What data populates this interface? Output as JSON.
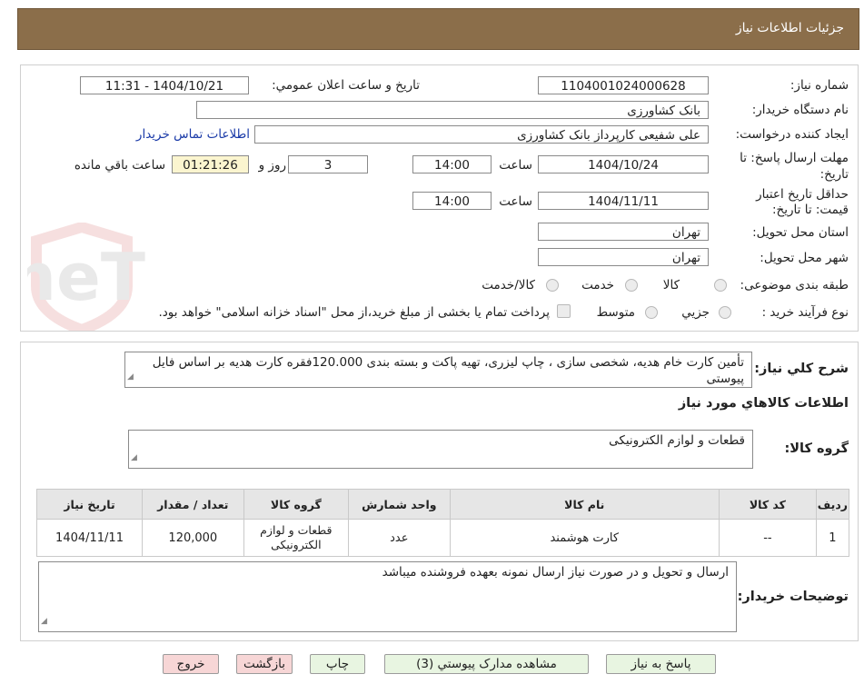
{
  "header": {
    "title": "جزئیات اطلاعات نیاز"
  },
  "watermark": {
    "text": "AriaTender.neT"
  },
  "form": {
    "need_number_label": "شماره نیاز:",
    "need_number": "1104001024000628",
    "announce_label": "تاریخ و ساعت اعلان عمومي:",
    "announce_value": "1404/10/21 - 11:31",
    "buyer_org_label": "نام دستگاه خريدار:",
    "buyer_org": "بانک کشاورزی",
    "creator_label": "ايجاد کننده درخواست:",
    "creator": "علی شفیعی کارپرداز بانک کشاورزی",
    "contact_link": "اطلاعات تماس خریدار",
    "deadline_label_1": "مهلت ارسال پاسخ: تا",
    "deadline_label_2": "تاريخ:",
    "deadline_date": "1404/10/24",
    "time_label": "ساعت",
    "deadline_time": "14:00",
    "days": "3",
    "days_label": "روز و",
    "remaining": "01:21:26",
    "remaining_label": "ساعت باقي مانده",
    "validity_label_1": "حداقل تاريخ اعتبار",
    "validity_label_2": "قيمت: تا تاريخ:",
    "validity_date": "1404/11/11",
    "validity_time_label": "ساعت",
    "validity_time": "14:00",
    "province_label": "استان محل تحويل:",
    "province": "تهران",
    "city_label": "شهر محل تحويل:",
    "city": "تهران",
    "category_label": "طبقه بندی موضوعی:",
    "category_options": [
      "کالا",
      "خدمت",
      "کالا/خدمت"
    ],
    "process_label": "نوع فرآيند خريد :",
    "process_options": [
      "جزيي",
      "متوسط"
    ],
    "payment_note": "پرداخت تمام يا بخشی از مبلغ خريد،از محل \"اسناد خزانه اسلامی\" خواهد بود."
  },
  "details": {
    "summary_label": "شرح كلي نياز:",
    "summary": "تأمین کارت خام هدیه، شخصی سازی ، چاپ لیزری، تهیه پاکت و بسته بندی  120.000فقره کارت هدیه بر اساس فایل پیوستی",
    "items_heading": "اطلاعات كالاهاي مورد نياز",
    "group_label": "گروه کالا:",
    "group_value": "قطعات و لوازم الکترونیکی",
    "table_headers": [
      "رديف",
      "کد کالا",
      "نام کالا",
      "واحد شمارش",
      "گروه کالا",
      "تعداد / مقدار",
      "تاريخ نياز"
    ],
    "rows": [
      [
        "1",
        "--",
        "کارت هوشمند",
        "عدد",
        "قطعات و لوازم الکترونیکی",
        "120,000",
        "1404/11/11"
      ]
    ],
    "buyer_notes_label": "توضيحات خريدار:",
    "buyer_notes": "ارسال و تحویل و در صورت نیاز ارسال نمونه بعهده فروشنده میباشد"
  },
  "buttons": {
    "reply": "پاسخ به نياز",
    "attachments": "مشاهده مدارک پيوستي (3)",
    "print": "چاپ",
    "back": "بازگشت",
    "exit": "خروج"
  }
}
